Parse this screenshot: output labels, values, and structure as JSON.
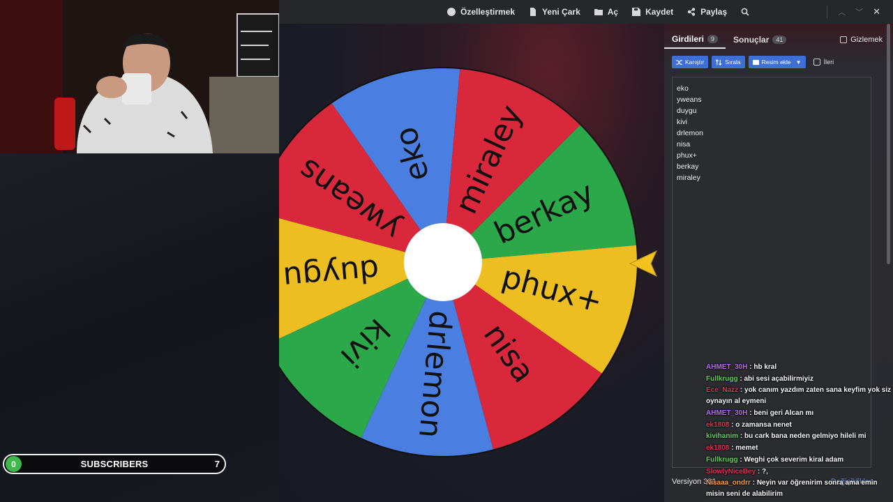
{
  "toolbar": {
    "customize": "Özelleştirmek",
    "new_wheel": "Yeni Çark",
    "open": "Aç",
    "save": "Kaydet",
    "share": "Paylaş"
  },
  "wheel": {
    "segments": [
      {
        "label": "eko",
        "color": "#4a7ee0"
      },
      {
        "label": "miraley",
        "color": "#d9283b"
      },
      {
        "label": "berkay",
        "color": "#2ba84a"
      },
      {
        "label": "phux+",
        "color": "#edbe22"
      },
      {
        "label": "nisa",
        "color": "#d9283b"
      },
      {
        "label": "drlemon",
        "color": "#4a7ee0"
      },
      {
        "label": "kivi",
        "color": "#2ba84a"
      },
      {
        "label": "duygu",
        "color": "#edbe22"
      },
      {
        "label": "ywеans",
        "color": "#d9283b"
      }
    ],
    "pointer_color": "#f2c21e"
  },
  "subscribers": {
    "current": "0",
    "label": "SUBSCRIBERS",
    "goal": "7"
  },
  "panel": {
    "tab_entries": "Girdileri",
    "tab_entries_count": "9",
    "tab_results": "Sonuçlar",
    "tab_results_count": "41",
    "hide_label": "Gizlemek",
    "shuffle_label": "Karıştır",
    "sort_label": "Sırala",
    "add_image_label": "Resim ekle",
    "advanced_label": "İleri",
    "entries": [
      "eko",
      "yweans",
      "duygu",
      "kivi",
      "drlemon",
      "nisa",
      "phux+",
      "berkay",
      "miraley"
    ],
    "version": "Versiyon 381",
    "changes": "Değişiklikler"
  },
  "chat": [
    {
      "user": "AHMET_30H",
      "color": "#b66cf0",
      "text": "hb kral"
    },
    {
      "user": "Fullkrugg",
      "color": "#5fd35a",
      "text": "abi sesi açabilirmiyiz"
    },
    {
      "user": "Ece_Nazz",
      "color": "#e0335a",
      "text": "yok canım yazdım zaten sana keyfim yok siz oynayın al eymeni"
    },
    {
      "user": "AHMET_30H",
      "color": "#b66cf0",
      "text": "beni geri Alcan mı"
    },
    {
      "user": "ek1808",
      "color": "#e0335a",
      "text": "o zamansa nenet"
    },
    {
      "user": "kivihanim",
      "color": "#5fd35a",
      "text": "bu cark bana neden gelmiyo hileli mi"
    },
    {
      "user": "ek1808",
      "color": "#e0335a",
      "text": "memet"
    },
    {
      "user": "Fullkrugg",
      "color": "#5fd35a",
      "text": "Weghi çok severim kiral adam"
    },
    {
      "user": "SlowlyNiceBey",
      "color": "#e0335a",
      "text": "?,"
    },
    {
      "user": "Nisaaa_ondrr",
      "color": "#f0a050",
      "text": "Neyin var öğrenirim sonra ama emin misin seni de alabilirim"
    }
  ]
}
